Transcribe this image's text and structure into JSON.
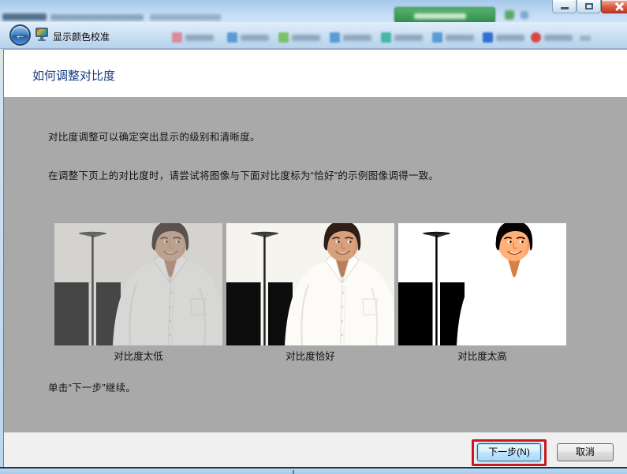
{
  "browser": {
    "green_button_color": "#3f9e52",
    "bookmark_icon_colors": [
      "#d98c9c",
      "#5b9bd5",
      "#7cbf6b",
      "#5b9bd5",
      "#49b5a3",
      "#5b9bd5",
      "#2f6fd0",
      "#d94545"
    ]
  },
  "wizard": {
    "titlebar": {
      "title": "显示颜色校准",
      "back_glyph": "←"
    },
    "header": {
      "title": "如何调整对比度"
    },
    "body": {
      "para1": "对比度调整可以确定突出显示的级别和清晰度。",
      "para2": "在调整下页上的对比度时，请尝试将图像与下面对比度标为“恰好”的示例图像调得一致。",
      "examples": [
        {
          "label": "对比度太低"
        },
        {
          "label": "对比度恰好"
        },
        {
          "label": "对比度太高"
        }
      ],
      "para3": "单击“下一步”继续。"
    },
    "footer": {
      "next_label": "下一步(N)",
      "cancel_label": "取消",
      "annotation_color": "#c8191e"
    },
    "colors": {
      "header_title": "#163a7e",
      "body_background": "#a9a9a9"
    }
  }
}
